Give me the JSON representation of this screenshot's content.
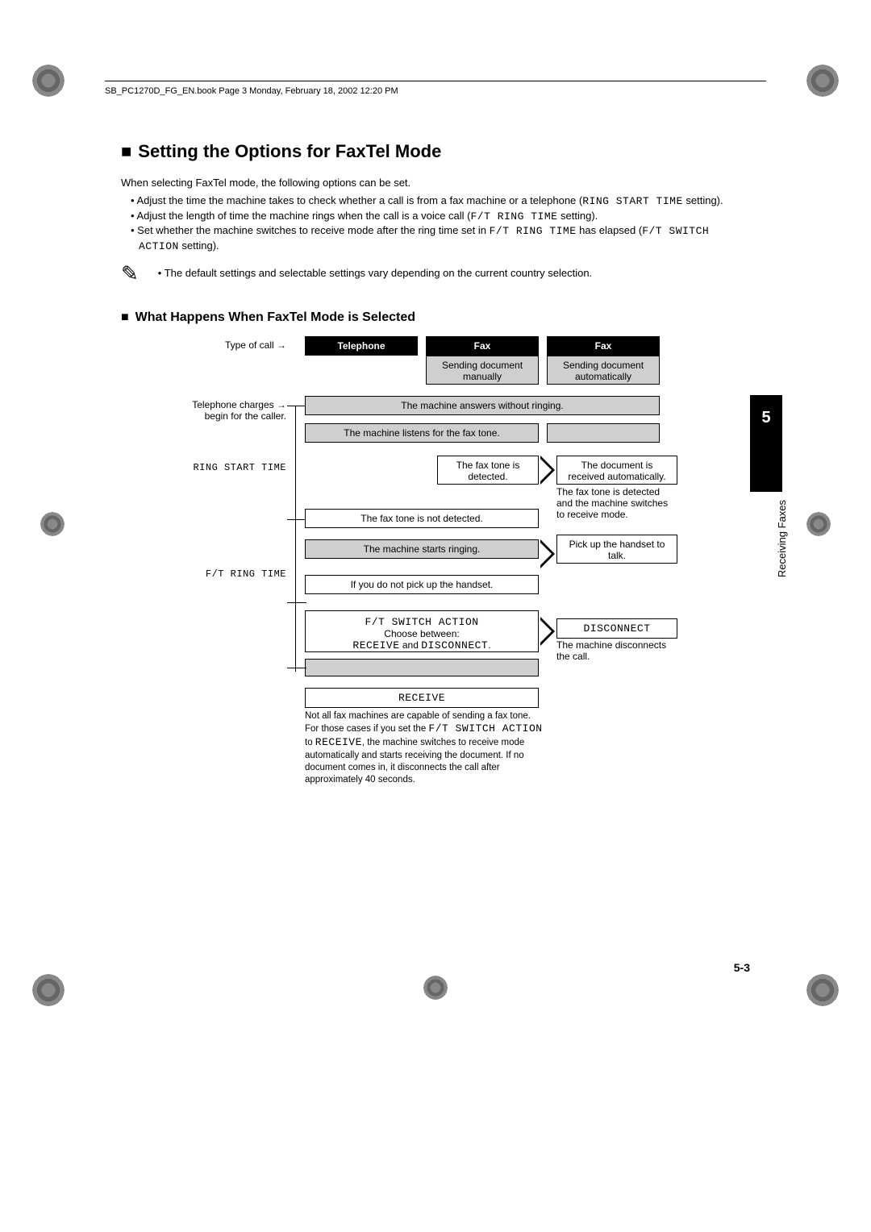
{
  "header": "SB_PC1270D_FG_EN.book  Page 3  Monday, February 18, 2002  12:20 PM",
  "title": "Setting the Options for FaxTel Mode",
  "intro": "When selecting FaxTel mode, the following options can be set.",
  "bullets": [
    {
      "pre": "Adjust the time the machine takes to check whether a call is from a fax machine or a telephone (",
      "code": "RING START TIME",
      "post": " setting)."
    },
    {
      "pre": "Adjust the length of time the machine rings when the call is a voice call (",
      "code": "F/T RING TIME",
      "post": " setting)."
    },
    {
      "pre": "Set whether the machine switches to receive mode after the ring time set in ",
      "code": "F/T RING TIME",
      "mid": " has elapsed (",
      "code2": "F/T SWITCH ACTION",
      "post": " setting)."
    }
  ],
  "note_bullet": "The default settings and selectable settings vary depending on the current country selection.",
  "subtitle": "What Happens When FaxTel Mode is Selected",
  "labels": {
    "type_of_call": "Type of call →",
    "telephone": "Telephone",
    "fax": "Fax",
    "send_manual": "Sending document manually",
    "send_auto": "Sending document automatically",
    "charges": "Telephone charges → begin for the caller.",
    "answers": "The machine answers without ringing.",
    "listens": "The machine listens for the fax tone.",
    "ring_start": "RING START TIME",
    "fax_detected": "The fax tone is detected.",
    "doc_received": "The document is received automatically.",
    "detected_switch": "The fax tone is detected and the machine switches to receive mode.",
    "not_detected": "The fax tone is not detected.",
    "starts_ringing": "The machine starts ringing.",
    "pickup": "Pick up the handset to talk.",
    "ft_ring": "F/T RING TIME",
    "no_pickup": "If you do not pick up the handset.",
    "ft_switch": "F/T SWITCH ACTION",
    "choose": "Choose between:",
    "receive_disconnect": "RECEIVE and DISCONNECT.",
    "disconnect": "DISCONNECT",
    "disconnect_call": "The machine disconnects the call.",
    "receive": "RECEIVE",
    "footnote": "Not all fax machines are capable of sending a fax tone. For those cases if you set the F/T SWITCH ACTION to RECEIVE, the machine switches to receive mode automatically and starts receiving the document. If no document comes in, it disconnects the call after approximately 40 seconds."
  },
  "chapter_num": "5",
  "chapter_label": "Receiving Faxes",
  "page_num": "5-3"
}
